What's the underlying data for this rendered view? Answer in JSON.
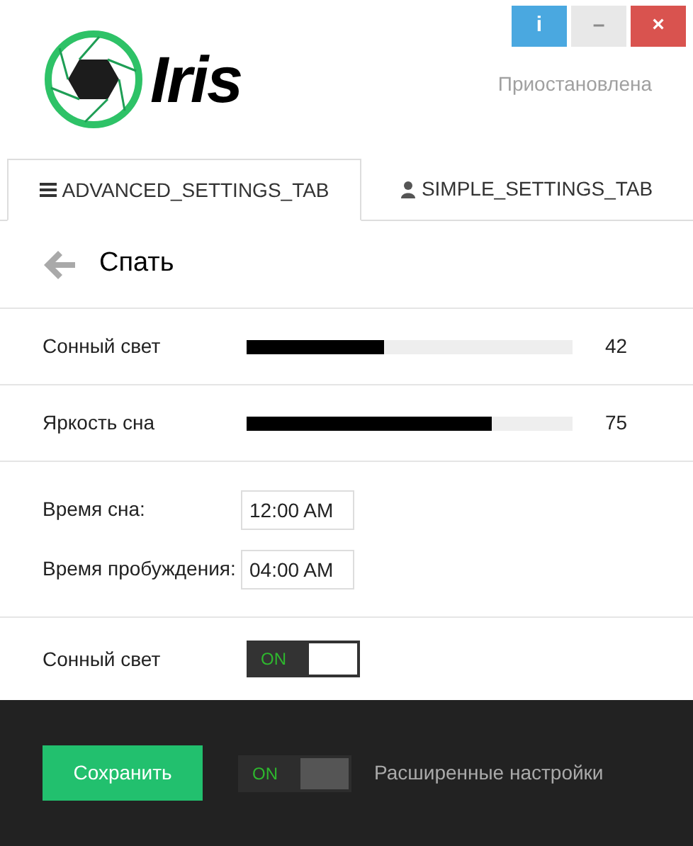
{
  "window": {
    "buttons": [
      {
        "kind": "info",
        "label": "i"
      },
      {
        "kind": "minimize",
        "label": "–"
      },
      {
        "kind": "close",
        "label": "×"
      }
    ]
  },
  "logo": {
    "text": "Iris"
  },
  "status": "Приостановлена",
  "tabs": [
    {
      "label": "ADVANCED_SETTINGS_TAB",
      "kind": "menu",
      "selected": true
    },
    {
      "label": "SIMPLE_SETTINGS_TAB",
      "kind": "user",
      "selected": false
    }
  ],
  "page_title": "Спать",
  "settings": [
    {
      "kind": "slider",
      "label": "Сонный свет",
      "level": 0.42,
      "reading": "42"
    },
    {
      "kind": "slider",
      "label": "Яркость сна",
      "level": 0.75,
      "reading": "75"
    },
    {
      "kind": "times",
      "fields": [
        {
          "label": "Время сна:",
          "value": "12:00 AM"
        },
        {
          "label": "Время пробуждения:",
          "value": "04:00 AM"
        }
      ]
    },
    {
      "kind": "toggle",
      "label": "Сонный свет",
      "on": true,
      "state_label": "ON"
    }
  ],
  "footer": {
    "save_button": "Сохранить",
    "toggle": {
      "on": true,
      "state_label": "ON"
    },
    "toggle_label": "Расширенные настройки"
  }
}
